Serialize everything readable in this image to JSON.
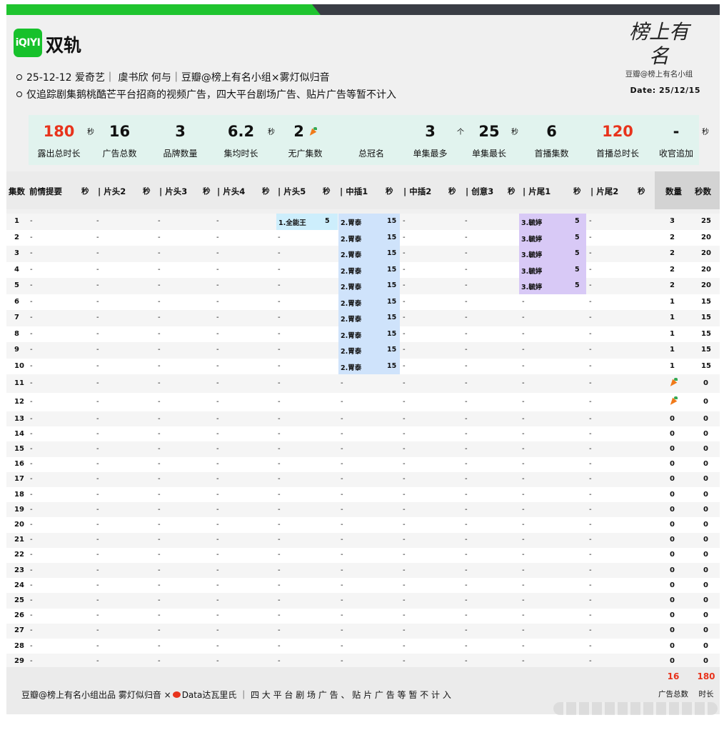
{
  "header": {
    "logo_text": "iQIYI",
    "title": "双轨",
    "brand_script": "榜上有名",
    "brand_sub": "豆瓣@榜上有名小组",
    "info1": "25-12-12 爱奇艺｜ 虞书欣 何与｜豆瓣@榜上有名小组×雾灯似归音",
    "info2": "仅追踪剧集鹅桃酷芒平台招商的视频广告，四大平台剧场广告、贴片广告等暂不计入",
    "date": "Date: 25/12/15"
  },
  "stats": [
    {
      "value": "180",
      "unit": "秒",
      "label": "露出总时长",
      "red": true
    },
    {
      "value": "16",
      "unit": "",
      "label": "广告总数",
      "red": false
    },
    {
      "value": "3",
      "unit": "",
      "label": "品牌数量",
      "red": false
    },
    {
      "value": "6.2",
      "unit": "秒",
      "label": "集均时长",
      "red": false
    },
    {
      "value": "2",
      "unit": "",
      "label": "无广集数",
      "red": false
    },
    {
      "value": "",
      "unit": "",
      "label": "总冠名",
      "red": false
    },
    {
      "value": "3",
      "unit": "个",
      "label": "单集最多",
      "red": false
    },
    {
      "value": "25",
      "unit": "秒",
      "label": "单集最长",
      "red": false
    },
    {
      "value": "6",
      "unit": "",
      "label": "首播集数",
      "red": false
    },
    {
      "value": "120",
      "unit": "",
      "label": "首播总时长",
      "red": true
    },
    {
      "value": "-",
      "unit": "秒",
      "label": "收官追加",
      "red": false
    }
  ],
  "columns": {
    "ep": "集数",
    "c1": "前情提要",
    "c2": "| 片头2",
    "c3": "| 片头3",
    "c4": "| 片头4",
    "c5": "| 片头5",
    "c6": "| 中插1",
    "c7": "| 中插2",
    "c8": "| 创意3",
    "c9": "| 片尾1",
    "c10": "| 片尾2",
    "sec": "秒",
    "count": "数量",
    "secs": "秒数"
  },
  "rows": [
    {
      "ep": "1",
      "p5": "1.全能王",
      "p5s": "5",
      "m1": "2.胃泰",
      "m1s": "15",
      "t1": "3.毓婷",
      "t1s": "5",
      "count": "3",
      "secs": "25"
    },
    {
      "ep": "2",
      "p5": "",
      "p5s": "",
      "m1": "2.胃泰",
      "m1s": "15",
      "t1": "3.毓婷",
      "t1s": "5",
      "count": "2",
      "secs": "20"
    },
    {
      "ep": "3",
      "p5": "",
      "p5s": "",
      "m1": "2.胃泰",
      "m1s": "15",
      "t1": "3.毓婷",
      "t1s": "5",
      "count": "2",
      "secs": "20"
    },
    {
      "ep": "4",
      "p5": "",
      "p5s": "",
      "m1": "2.胃泰",
      "m1s": "15",
      "t1": "3.毓婷",
      "t1s": "5",
      "count": "2",
      "secs": "20"
    },
    {
      "ep": "5",
      "p5": "",
      "p5s": "",
      "m1": "2.胃泰",
      "m1s": "15",
      "t1": "3.毓婷",
      "t1s": "5",
      "count": "2",
      "secs": "20"
    },
    {
      "ep": "6",
      "p5": "",
      "p5s": "",
      "m1": "2.胃泰",
      "m1s": "15",
      "t1": "",
      "t1s": "",
      "count": "1",
      "secs": "15"
    },
    {
      "ep": "7",
      "p5": "",
      "p5s": "",
      "m1": "2.胃泰",
      "m1s": "15",
      "t1": "",
      "t1s": "",
      "count": "1",
      "secs": "15"
    },
    {
      "ep": "8",
      "p5": "",
      "p5s": "",
      "m1": "2.胃泰",
      "m1s": "15",
      "t1": "",
      "t1s": "",
      "count": "1",
      "secs": "15"
    },
    {
      "ep": "9",
      "p5": "",
      "p5s": "",
      "m1": "2.胃泰",
      "m1s": "15",
      "t1": "",
      "t1s": "",
      "count": "1",
      "secs": "15"
    },
    {
      "ep": "10",
      "p5": "",
      "p5s": "",
      "m1": "2.胃泰",
      "m1s": "15",
      "t1": "",
      "t1s": "",
      "count": "1",
      "secs": "15"
    },
    {
      "ep": "11",
      "p5": "",
      "p5s": "",
      "m1": "",
      "m1s": "",
      "t1": "",
      "t1s": "",
      "count": "carrot",
      "secs": "0"
    },
    {
      "ep": "12",
      "p5": "",
      "p5s": "",
      "m1": "",
      "m1s": "",
      "t1": "",
      "t1s": "",
      "count": "carrot",
      "secs": "0"
    },
    {
      "ep": "13",
      "p5": "",
      "p5s": "",
      "m1": "",
      "m1s": "",
      "t1": "",
      "t1s": "",
      "count": "0",
      "secs": "0"
    },
    {
      "ep": "14",
      "p5": "",
      "p5s": "",
      "m1": "",
      "m1s": "",
      "t1": "",
      "t1s": "",
      "count": "0",
      "secs": "0"
    },
    {
      "ep": "15",
      "p5": "",
      "p5s": "",
      "m1": "",
      "m1s": "",
      "t1": "",
      "t1s": "",
      "count": "0",
      "secs": "0"
    },
    {
      "ep": "16",
      "p5": "",
      "p5s": "",
      "m1": "",
      "m1s": "",
      "t1": "",
      "t1s": "",
      "count": "0",
      "secs": "0"
    },
    {
      "ep": "17",
      "p5": "",
      "p5s": "",
      "m1": "",
      "m1s": "",
      "t1": "",
      "t1s": "",
      "count": "0",
      "secs": "0"
    },
    {
      "ep": "18",
      "p5": "",
      "p5s": "",
      "m1": "",
      "m1s": "",
      "t1": "",
      "t1s": "",
      "count": "0",
      "secs": "0"
    },
    {
      "ep": "19",
      "p5": "",
      "p5s": "",
      "m1": "",
      "m1s": "",
      "t1": "",
      "t1s": "",
      "count": "0",
      "secs": "0"
    },
    {
      "ep": "20",
      "p5": "",
      "p5s": "",
      "m1": "",
      "m1s": "",
      "t1": "",
      "t1s": "",
      "count": "0",
      "secs": "0"
    },
    {
      "ep": "21",
      "p5": "",
      "p5s": "",
      "m1": "",
      "m1s": "",
      "t1": "",
      "t1s": "",
      "count": "0",
      "secs": "0"
    },
    {
      "ep": "22",
      "p5": "",
      "p5s": "",
      "m1": "",
      "m1s": "",
      "t1": "",
      "t1s": "",
      "count": "0",
      "secs": "0"
    },
    {
      "ep": "23",
      "p5": "",
      "p5s": "",
      "m1": "",
      "m1s": "",
      "t1": "",
      "t1s": "",
      "count": "0",
      "secs": "0"
    },
    {
      "ep": "24",
      "p5": "",
      "p5s": "",
      "m1": "",
      "m1s": "",
      "t1": "",
      "t1s": "",
      "count": "0",
      "secs": "0"
    },
    {
      "ep": "25",
      "p5": "",
      "p5s": "",
      "m1": "",
      "m1s": "",
      "t1": "",
      "t1s": "",
      "count": "0",
      "secs": "0"
    },
    {
      "ep": "26",
      "p5": "",
      "p5s": "",
      "m1": "",
      "m1s": "",
      "t1": "",
      "t1s": "",
      "count": "0",
      "secs": "0"
    },
    {
      "ep": "27",
      "p5": "",
      "p5s": "",
      "m1": "",
      "m1s": "",
      "t1": "",
      "t1s": "",
      "count": "0",
      "secs": "0"
    },
    {
      "ep": "28",
      "p5": "",
      "p5s": "",
      "m1": "",
      "m1s": "",
      "t1": "",
      "t1s": "",
      "count": "0",
      "secs": "0"
    },
    {
      "ep": "29",
      "p5": "",
      "p5s": "",
      "m1": "",
      "m1s": "",
      "t1": "",
      "t1s": "",
      "count": "0",
      "secs": "0"
    }
  ],
  "empty_mark": "-",
  "footer": {
    "text_a": "豆瓣@榜上有名小组出品  雾灯似归音 ×",
    "text_b": "Data达瓦里氏 ｜ 四 大 平 台 剧 场 广 告 、 贴 片 广 告 等 暂 不 计 入",
    "total_count": "16",
    "total_secs": "180",
    "count_label": "广告总数",
    "secs_label": "时长"
  },
  "colors": {
    "green": "#1fc42f",
    "red": "#e8331c",
    "blue_ad": "#cfe3fb",
    "cyan_ad": "#cdeefc",
    "purple_ad": "#d8c9f6",
    "stats_bg": "#e1f3ee"
  }
}
